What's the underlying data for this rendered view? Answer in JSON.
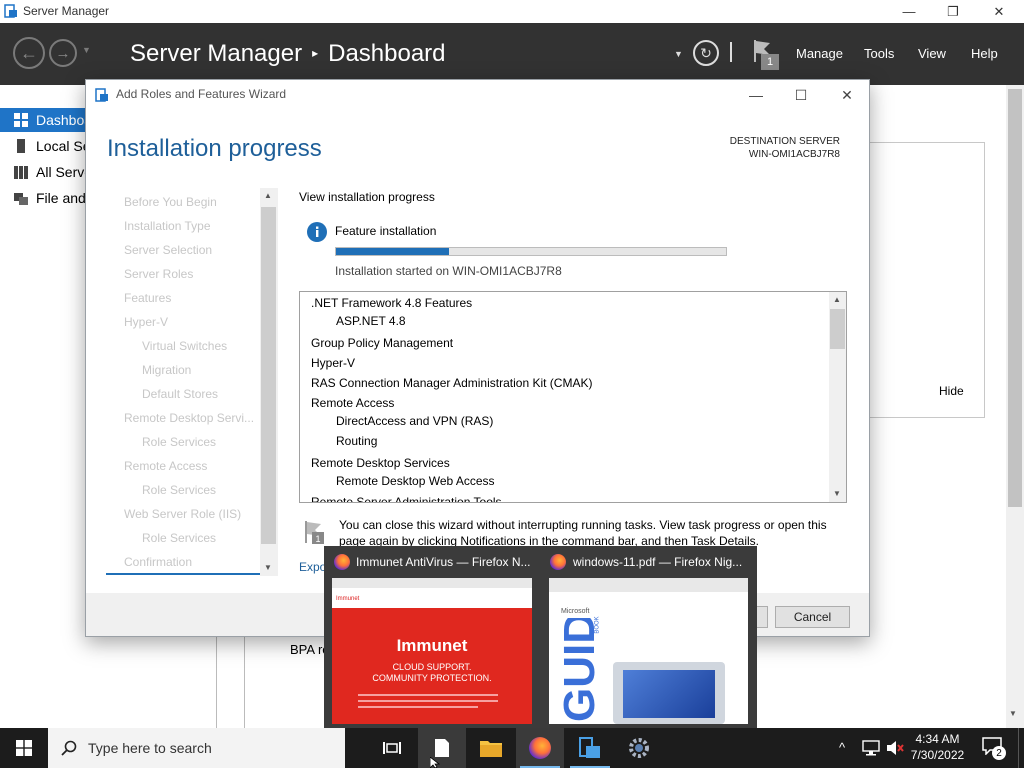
{
  "window": {
    "title": "Server Manager",
    "minimize": "—",
    "maximize": "❐",
    "close": "✕"
  },
  "header": {
    "app_name": "Server Manager",
    "page": "Dashboard",
    "separator": "▸",
    "notification_count": "1",
    "menu": [
      "Manage",
      "Tools",
      "View",
      "Help"
    ]
  },
  "sidebar": {
    "items": [
      {
        "label": "Dashboard",
        "icon": "dashboard-icon",
        "active": true
      },
      {
        "label": "Local Server",
        "icon": "server-icon",
        "active": false
      },
      {
        "label": "All Servers",
        "icon": "servers-icon",
        "active": false
      },
      {
        "label": "File and Storage Services",
        "icon": "storage-icon",
        "active": false
      }
    ]
  },
  "background": {
    "hide_label": "Hide",
    "bpa_label": "BPA res"
  },
  "wizard": {
    "title": "Add Roles and Features Wizard",
    "heading": "Installation progress",
    "destination_label": "DESTINATION SERVER",
    "destination_server": "WIN-OMI1ACBJ7R8",
    "steps": [
      {
        "label": "Before You Begin",
        "indent": 0
      },
      {
        "label": "Installation Type",
        "indent": 0
      },
      {
        "label": "Server Selection",
        "indent": 0
      },
      {
        "label": "Server Roles",
        "indent": 0
      },
      {
        "label": "Features",
        "indent": 0
      },
      {
        "label": "Hyper-V",
        "indent": 0
      },
      {
        "label": "Virtual Switches",
        "indent": 1
      },
      {
        "label": "Migration",
        "indent": 1
      },
      {
        "label": "Default Stores",
        "indent": 1
      },
      {
        "label": "Remote Desktop Servi...",
        "indent": 0
      },
      {
        "label": "Role Services",
        "indent": 1
      },
      {
        "label": "Remote Access",
        "indent": 0
      },
      {
        "label": "Role Services",
        "indent": 1
      },
      {
        "label": "Web Server Role (IIS)",
        "indent": 0
      },
      {
        "label": "Role Services",
        "indent": 1
      },
      {
        "label": "Confirmation",
        "indent": 0
      }
    ],
    "view_progress_label": "View installation progress",
    "feature_installation_label": "Feature installation",
    "progress": 0.29,
    "install_status": "Installation started on WIN-OMI1ACBJ7R8",
    "features": [
      {
        "label": ".NET Framework 4.8 Features",
        "indent": 0
      },
      {
        "label": "ASP.NET 4.8",
        "indent": 1
      },
      {
        "label": "Group Policy Management",
        "indent": 0
      },
      {
        "label": "Hyper-V",
        "indent": 0
      },
      {
        "label": "RAS Connection Manager Administration Kit (CMAK)",
        "indent": 0
      },
      {
        "label": "Remote Access",
        "indent": 0
      },
      {
        "label": "DirectAccess and VPN (RAS)",
        "indent": 1
      },
      {
        "label": "Routing",
        "indent": 1
      },
      {
        "label": "Remote Desktop Services",
        "indent": 0
      },
      {
        "label": "Remote Desktop Web Access",
        "indent": 1
      },
      {
        "label": "Remote Server Administration Tools",
        "indent": 0
      }
    ],
    "notice_line1": "You can close this wizard without interrupting running tasks. View task progress or open this",
    "notice_line2": "page again by clicking Notifications in the command bar, and then Task Details.",
    "export_label": "Export configuration settings",
    "cancel_label": "Cancel"
  },
  "thumbnails": [
    {
      "title": "Immunet AntiVirus — Firefox N...",
      "brand": "Immunet",
      "tagline1": "CLOUD SUPPORT.",
      "tagline2": "COMMUNITY PROTECTION."
    },
    {
      "title": "windows-11.pdf — Firefox Nig...",
      "brand": "Microsoft",
      "side_text": "GUIDE",
      "book_label": "BOOK"
    }
  ],
  "taskbar": {
    "search_placeholder": "Type here to search",
    "time": "4:34 AM",
    "date": "7/30/2022",
    "notification_badge": "2",
    "tray_chevron": "^"
  }
}
